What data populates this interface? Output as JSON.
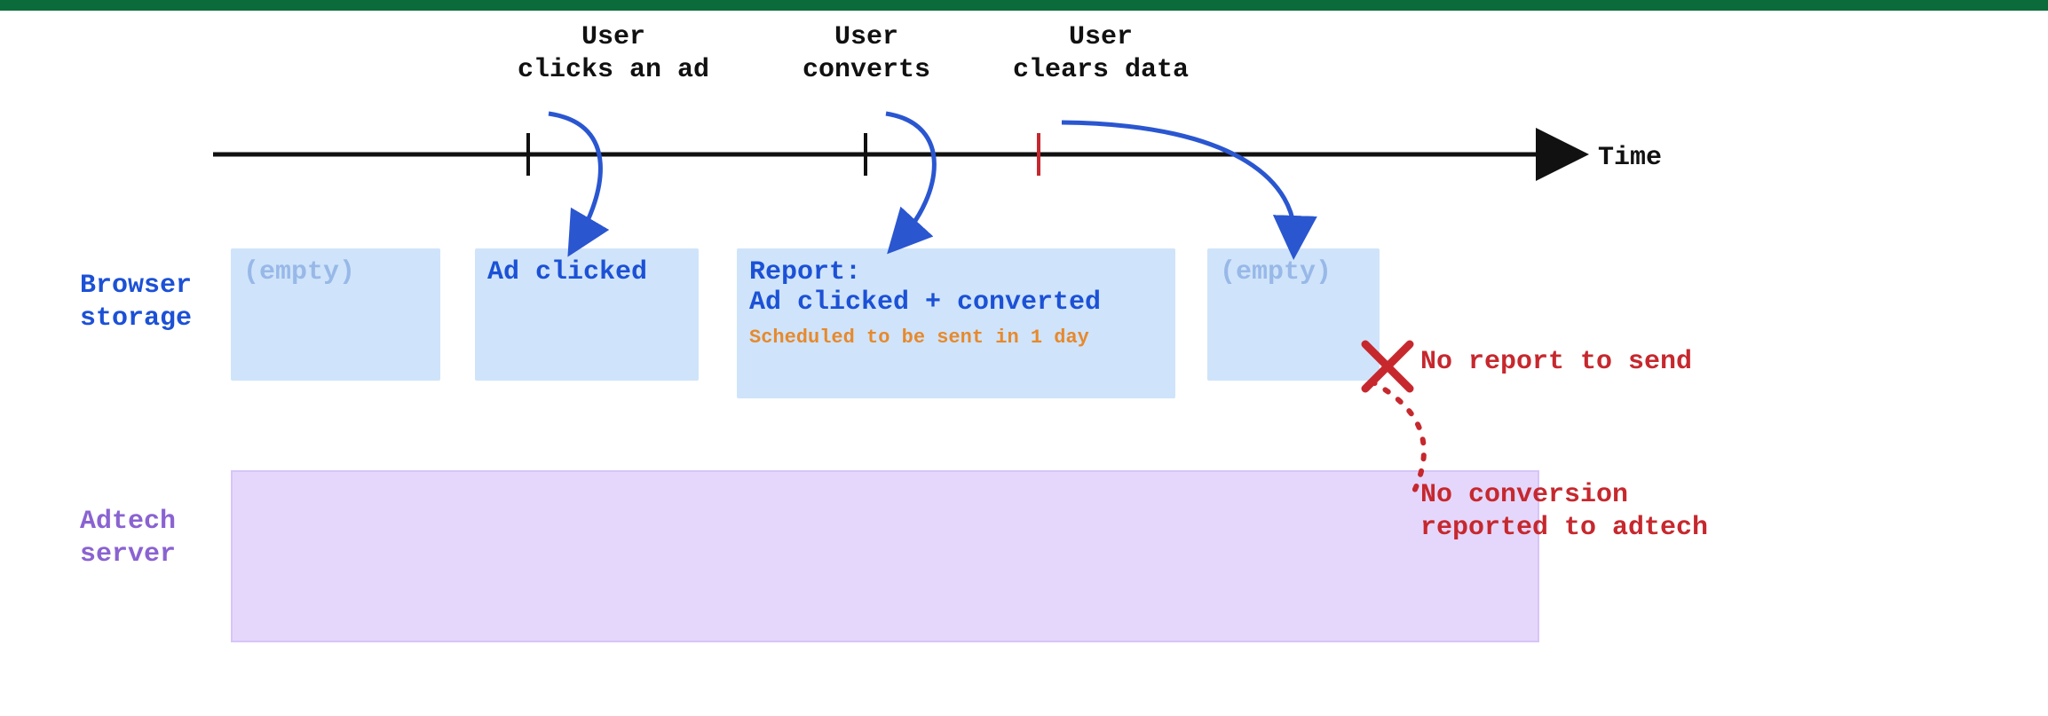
{
  "axis": {
    "label": "Time"
  },
  "events": {
    "click": "User\nclicks an ad",
    "convert": "User\nconverts",
    "clear": "User\nclears data"
  },
  "rows": {
    "browser": "Browser\nstorage",
    "adtech": "Adtech\nserver"
  },
  "storage": {
    "empty": "(empty)",
    "clicked": "Ad clicked",
    "report_title": "Report:",
    "report_body": "Ad clicked + converted",
    "report_sub": "Scheduled to be sent in 1 day",
    "empty2": "(empty)"
  },
  "errors": {
    "no_report": "No report to send",
    "no_conversion": "No conversion\nreported to adtech"
  },
  "colors": {
    "timeline": "#111111",
    "arrow": "#2a56d0",
    "red_tick": "#c6282e",
    "send_path": "#c6282e"
  }
}
